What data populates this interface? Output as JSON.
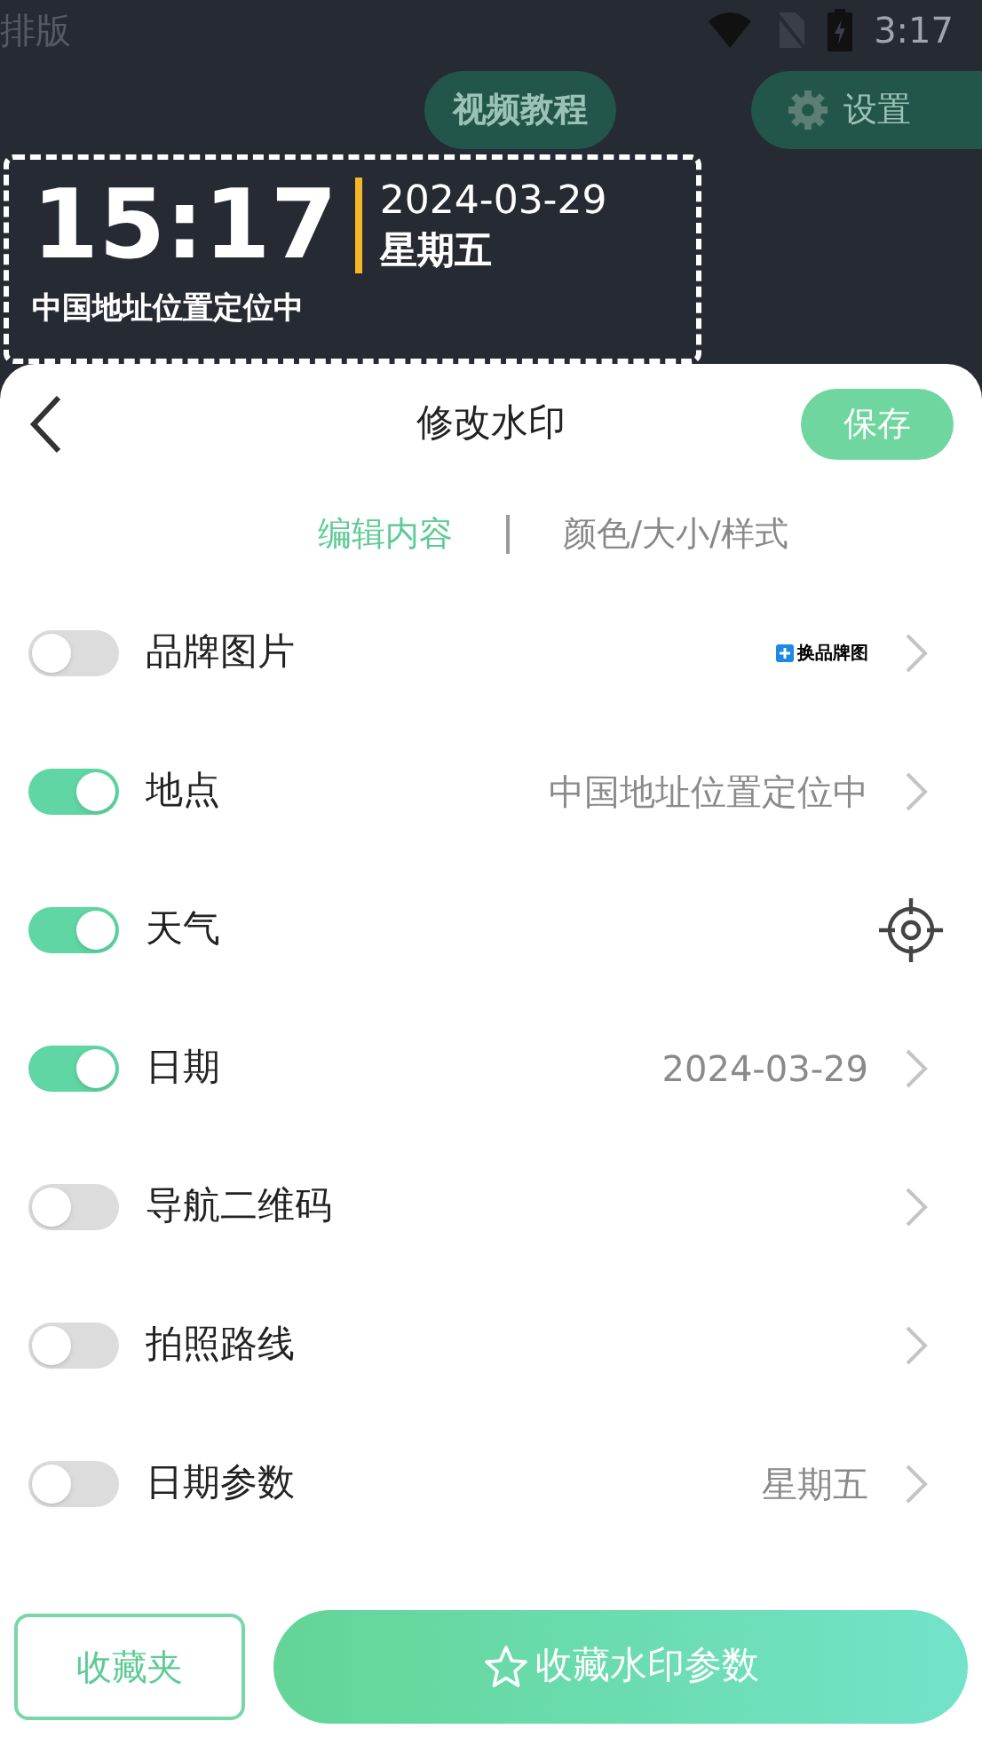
{
  "status_bar": {
    "app_label": "排版",
    "time": "3:17"
  },
  "background_buttons": [
    {
      "label": "视频教程",
      "kind": "plain"
    },
    {
      "label": "设置",
      "kind": "gear"
    }
  ],
  "watermark_preview": {
    "time": "15:17",
    "date": "2024-03-29",
    "weekday": "星期五",
    "location": "中国地址位置定位中"
  },
  "sheet": {
    "title": "修改水印",
    "save": "保存"
  },
  "tabs": [
    {
      "label": "编辑内容",
      "selected": true
    },
    {
      "label": "颜色/大小/样式",
      "selected": false
    }
  ],
  "rows": [
    {
      "label": "品牌图片",
      "on": false,
      "kind": "badge",
      "value": "换品牌图"
    },
    {
      "label": "地点",
      "on": true,
      "kind": "text",
      "value": "中国地址位置定位中"
    },
    {
      "label": "天气",
      "on": true,
      "kind": "locate"
    },
    {
      "label": "日期",
      "on": true,
      "kind": "text",
      "value": "2024-03-29"
    },
    {
      "label": "导航二维码",
      "on": false,
      "kind": "none"
    },
    {
      "label": "拍照路线",
      "on": false,
      "kind": "none"
    },
    {
      "label": "日期参数",
      "on": false,
      "kind": "text",
      "value": "星期五"
    }
  ],
  "footer": {
    "favorites": "收藏夹",
    "save_params": "收藏水印参数"
  }
}
